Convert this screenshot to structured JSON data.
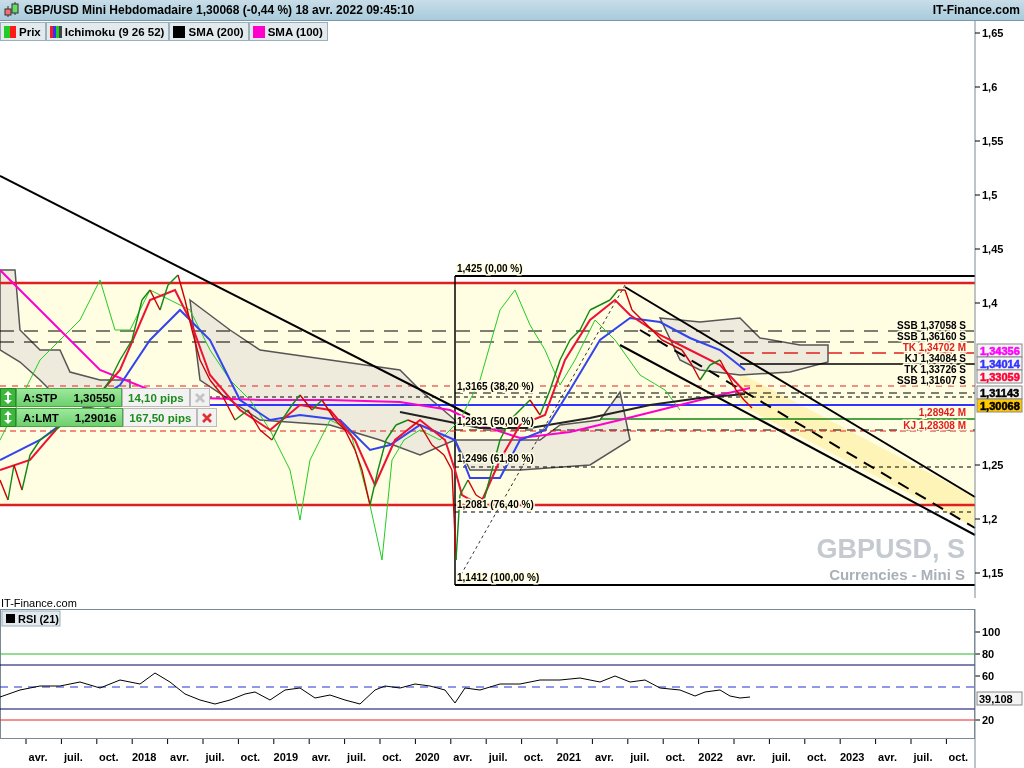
{
  "header": {
    "title": "GBP/USD Mini Hebdomadaire 1,30068 (-0,44 %) 18 avr. 2022 09:45:10",
    "source": "IT-Finance.com"
  },
  "legend": [
    {
      "label": "Prix",
      "kind": "price"
    },
    {
      "label": "Ichimoku (9 26 52)",
      "kind": "ichimoku"
    },
    {
      "label": "SMA (200)",
      "kind": "line",
      "color": "#000000"
    },
    {
      "label": "SMA (100)",
      "kind": "line",
      "color": "#ff00cc"
    }
  ],
  "price_axis": {
    "ticks": [
      "1,65",
      "1,6",
      "1,55",
      "1,5",
      "1,45",
      "1,4",
      "1,25",
      "1,2",
      "1,15"
    ]
  },
  "price_tags": [
    {
      "text": "1,34356",
      "kind": "plain",
      "color": "#ff00ff"
    },
    {
      "text": "1,34014",
      "kind": "plain",
      "color": "#3333ff"
    },
    {
      "text": "1,33059",
      "kind": "plain",
      "color": "#ff0033"
    },
    {
      "text": "1,31143",
      "kind": "plain",
      "color": "#000000"
    },
    {
      "text": "1,30068",
      "kind": "current"
    }
  ],
  "level_labels": [
    {
      "text": "SSB 1,37058 S",
      "color": "#000000"
    },
    {
      "text": "SSB 1,36160 S",
      "color": "#000000"
    },
    {
      "text": "TK 1,34702 M",
      "color": "#e02020"
    },
    {
      "text": "KJ 1,34084 S",
      "color": "#000000"
    },
    {
      "text": "TK 1,33726 S",
      "color": "#000000"
    },
    {
      "text": "SSB 1,31607 S",
      "color": "#000000"
    },
    {
      "text": "1,28942 M",
      "color": "#e02020"
    },
    {
      "text": "KJ 1,28308 M",
      "color": "#e02020"
    }
  ],
  "fib_labels": [
    "1,425 (0,00 %)",
    "1,3165 (38,20 %)",
    "1,2831 (50,00 %)",
    "1,2496 (61,80 %)",
    "1,2081 (76,40 %)",
    "1,1412 (100,00 %)"
  ],
  "orders": [
    {
      "label": "A:STP",
      "price": "1,30550",
      "pips": "14,10 pips",
      "disabled": true
    },
    {
      "label": "A:LMT",
      "price": "1,29016",
      "pips": "167,50 pips",
      "disabled": false
    }
  ],
  "watermark": {
    "symbol": "GBPUSD, S",
    "subtitle": "Currencies - Mini S"
  },
  "source_label": "IT-Finance.com",
  "rsi": {
    "title": "RSI (21)",
    "ticks": [
      "100",
      "80",
      "60",
      "20"
    ],
    "value": "39,108"
  },
  "time_axis": [
    "avr.",
    "juil.",
    "oct.",
    "2018",
    "avr.",
    "juil.",
    "oct.",
    "2019",
    "avr.",
    "juil.",
    "oct.",
    "2020",
    "avr.",
    "juil.",
    "oct.",
    "2021",
    "avr.",
    "juil.",
    "oct.",
    "2022",
    "avr.",
    "juil.",
    "oct.",
    "2023",
    "avr.",
    "juil.",
    "oct."
  ]
}
